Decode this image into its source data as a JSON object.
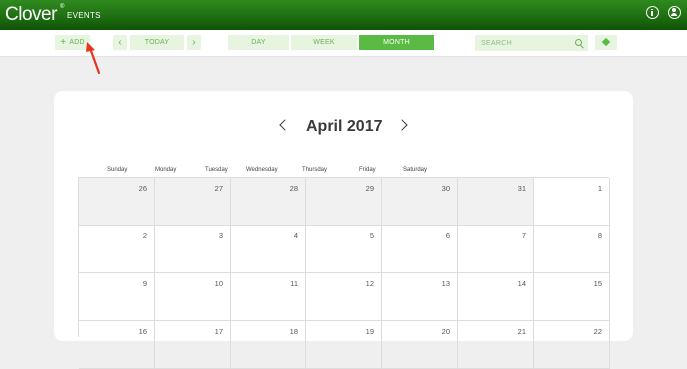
{
  "app": {
    "logo": "Clover",
    "logo_mark": "®",
    "section": "EVENTS"
  },
  "header_icons": [
    "info-icon",
    "user-icon"
  ],
  "toolbar": {
    "add_label": "ADD",
    "add_icon": "+",
    "prev_icon": "‹",
    "today_label": "TODAY",
    "next_icon": "›",
    "views": [
      "DAY",
      "WEEK",
      "MONTH"
    ],
    "active_view": "MONTH",
    "search_placeholder": "SEARCH"
  },
  "calendar": {
    "title": "April 2017",
    "weekdays": [
      "Sunday",
      "Monday",
      "Tuesday",
      "Wednesday",
      "Thursday",
      "Friday",
      "Saturday"
    ],
    "weeks": [
      [
        {
          "day": "26",
          "other": true
        },
        {
          "day": "27",
          "other": true
        },
        {
          "day": "28",
          "other": true
        },
        {
          "day": "29",
          "other": true
        },
        {
          "day": "30",
          "other": true
        },
        {
          "day": "31",
          "other": true
        },
        {
          "day": "1",
          "other": false
        }
      ],
      [
        {
          "day": "2",
          "other": false
        },
        {
          "day": "3",
          "other": false
        },
        {
          "day": "4",
          "other": false
        },
        {
          "day": "5",
          "other": false
        },
        {
          "day": "6",
          "other": false
        },
        {
          "day": "7",
          "other": false
        },
        {
          "day": "8",
          "other": false
        }
      ],
      [
        {
          "day": "9",
          "other": false
        },
        {
          "day": "10",
          "other": false
        },
        {
          "day": "11",
          "other": false
        },
        {
          "day": "12",
          "other": false
        },
        {
          "day": "13",
          "other": false
        },
        {
          "day": "14",
          "other": false
        },
        {
          "day": "15",
          "other": false
        }
      ],
      [
        {
          "day": "16",
          "other": false
        },
        {
          "day": "17",
          "other": false
        },
        {
          "day": "18",
          "other": false
        },
        {
          "day": "19",
          "other": false
        },
        {
          "day": "20",
          "other": false
        },
        {
          "day": "21",
          "other": false
        },
        {
          "day": "22",
          "other": false
        }
      ]
    ]
  },
  "colors": {
    "header_green": "#1f6f12",
    "accent_green": "#5aba44",
    "button_bg": "#e6f4e0",
    "annotation_arrow": "#e8341c"
  }
}
